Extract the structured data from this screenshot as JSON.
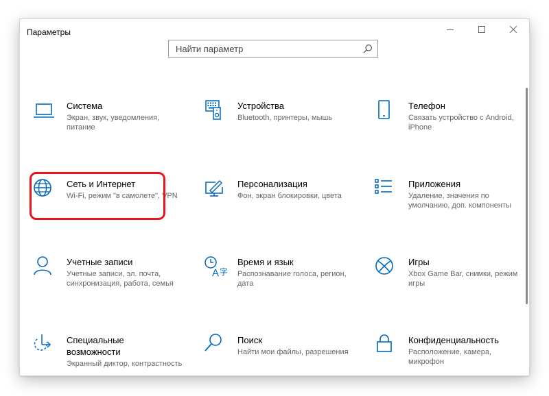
{
  "window": {
    "title": "Параметры"
  },
  "search": {
    "placeholder": "Найти параметр"
  },
  "colors": {
    "accent": "#0067c0",
    "highlight": "#e8141d",
    "subtitle": "#666666"
  },
  "tiles": [
    {
      "title": "Система",
      "desc": "Экран, звук, уведомления, питание",
      "icon": "laptop-icon"
    },
    {
      "title": "Устройства",
      "desc": "Bluetooth, принтеры, мышь",
      "icon": "devices-icon"
    },
    {
      "title": "Телефон",
      "desc": "Связать устройство с Android, iPhone",
      "icon": "phone-icon"
    },
    {
      "title": "Сеть и Интернет",
      "desc": "Wi-Fi, режим \"в самолете\", VPN",
      "icon": "globe-icon"
    },
    {
      "title": "Персонализация",
      "desc": "Фон, экран блокировки, цвета",
      "icon": "personalization-icon"
    },
    {
      "title": "Приложения",
      "desc": "Удаление, значения по умолчанию, доп. компоненты",
      "icon": "apps-list-icon"
    },
    {
      "title": "Учетные записи",
      "desc": "Учетные записи, эл. почта, синхронизация, работа, семья",
      "icon": "person-icon"
    },
    {
      "title": "Время и язык",
      "desc": "Распознавание голоса, регион, дата",
      "icon": "time-language-icon"
    },
    {
      "title": "Игры",
      "desc": "Xbox Game Bar, снимки, режим игры",
      "icon": "xbox-icon"
    },
    {
      "title": "Специальные возможности",
      "desc": "Экранный диктор, контрастность",
      "icon": "accessibility-icon"
    },
    {
      "title": "Поиск",
      "desc": "Найти мои файлы, разрешения",
      "icon": "search-icon"
    },
    {
      "title": "Конфиденциальность",
      "desc": "Расположение, камера, микрофон",
      "icon": "lock-icon"
    }
  ]
}
